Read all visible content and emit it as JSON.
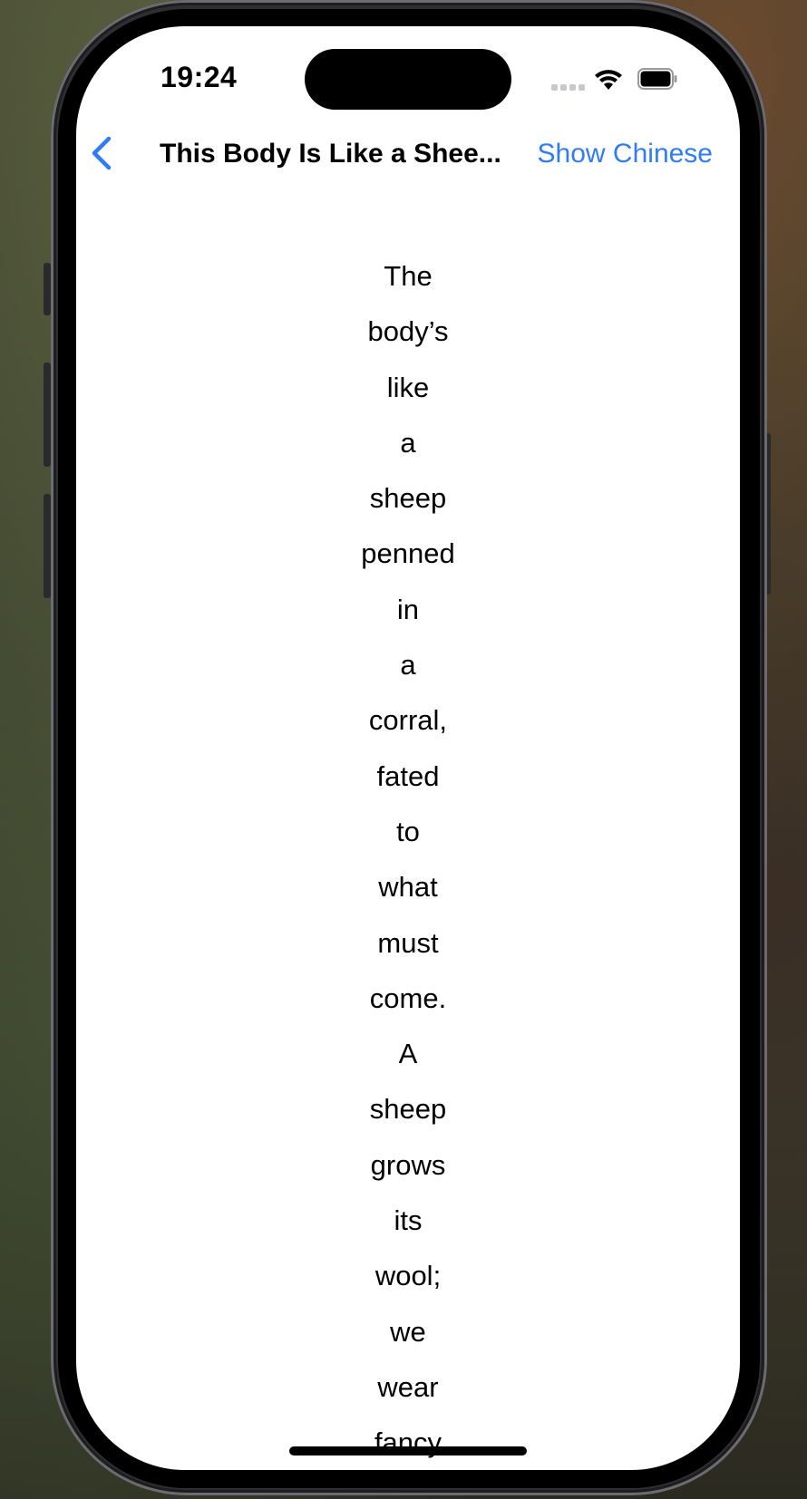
{
  "status_bar": {
    "time": "19:24",
    "signal_icon": "cellular-signal-icon",
    "wifi_icon": "wifi-icon",
    "battery_icon": "battery-icon"
  },
  "nav_bar": {
    "back_icon": "chevron-left-icon",
    "title": "This Body Is Like a Shee...",
    "action_label": "Show Chinese",
    "accent_color": "#2f7cf6"
  },
  "poem": {
    "lines": [
      "The",
      "body’s",
      "like",
      "a",
      "sheep",
      "penned",
      "in",
      "a",
      "corral,",
      "fated",
      "to",
      "what",
      "must",
      "come.",
      "A",
      "sheep",
      "grows",
      "its",
      "wool;",
      "we",
      "wear",
      "fancy"
    ]
  }
}
